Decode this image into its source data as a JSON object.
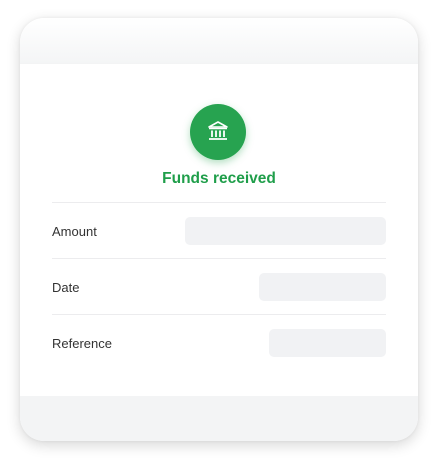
{
  "status": {
    "icon": "bank-icon",
    "title": "Funds received",
    "color": "#27a350"
  },
  "details": [
    {
      "label": "Amount",
      "value": ""
    },
    {
      "label": "Date",
      "value": ""
    },
    {
      "label": "Reference",
      "value": ""
    }
  ]
}
